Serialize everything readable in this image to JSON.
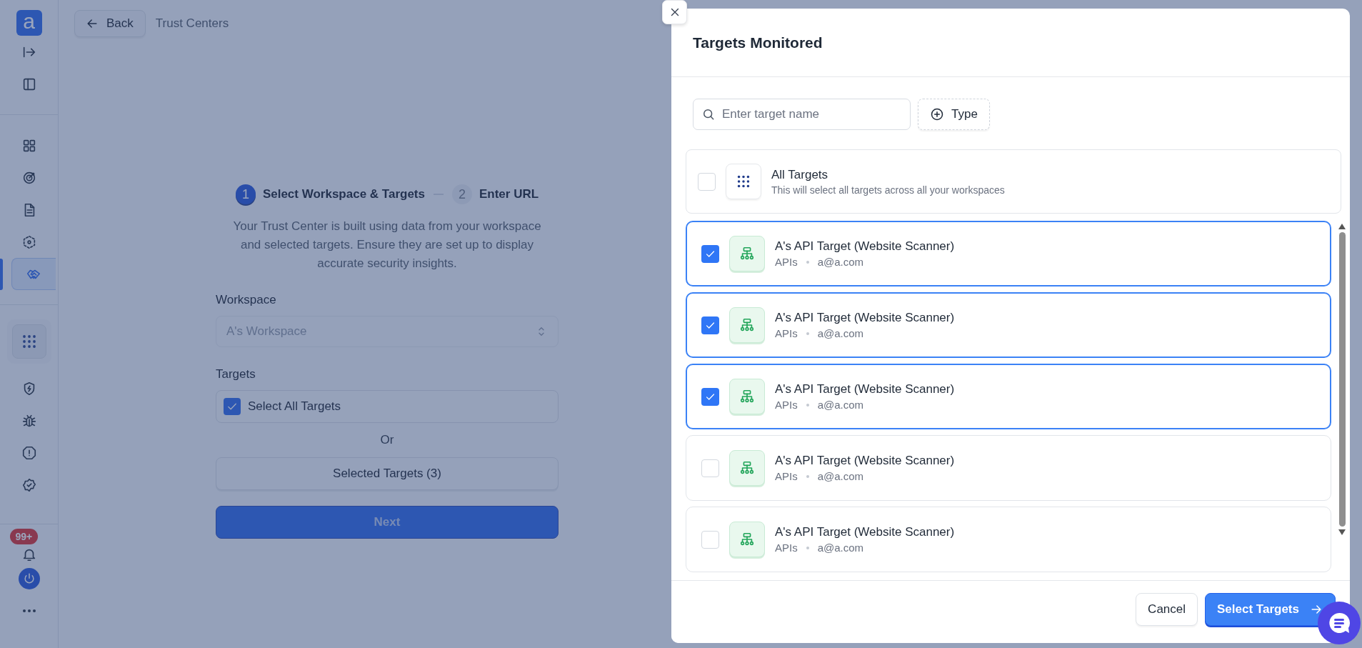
{
  "sidebar": {
    "logo": "a",
    "nav_items": [
      {
        "selected": false
      },
      {
        "selected": false
      },
      {
        "selected": false
      },
      {
        "selected": false
      },
      {
        "selected": true
      }
    ],
    "notification_badge": "99+"
  },
  "top_bar": {
    "back_button": "Back",
    "breadcrumb": "Trust Centers"
  },
  "stepper": [
    {
      "number": "1",
      "label": "Select Workspace & Targets",
      "active": true
    },
    {
      "number": "2",
      "label": "Enter URL",
      "active": false
    }
  ],
  "description": "Your Trust Center is built using data from your workspace and selected targets. Ensure they are set up to display accurate security insights.",
  "workspace": {
    "label": "Workspace",
    "value": "A's Workspace",
    "disabled": true
  },
  "targets": {
    "label": "Targets",
    "select_all": {
      "label": "Select All Targets",
      "checked": true
    },
    "or_text": "Or",
    "selected_button": "Selected Targets (3)",
    "next_button": "Next"
  },
  "modal": {
    "title": "Targets Monitored",
    "search": {
      "placeholder": "Enter target name"
    },
    "type_button": "Type",
    "all_targets": {
      "title": "All Targets",
      "subtitle": "This will select all targets across all your workspaces",
      "checked": false
    },
    "items": [
      {
        "name": "A's API Target (Website Scanner)",
        "type": "APIs",
        "owner": "a@a.com",
        "checked": true
      },
      {
        "name": "A's API Target (Website Scanner)",
        "type": "APIs",
        "owner": "a@a.com",
        "checked": true
      },
      {
        "name": "A's API Target (Website Scanner)",
        "type": "APIs",
        "owner": "a@a.com",
        "checked": true
      },
      {
        "name": "A's API Target (Website Scanner)",
        "type": "APIs",
        "owner": "a@a.com",
        "checked": false
      },
      {
        "name": "A's API Target (Website Scanner)",
        "type": "APIs",
        "owner": "a@a.com",
        "checked": false
      }
    ],
    "cancel_button": "Cancel",
    "confirm_button": "Select Targets"
  }
}
